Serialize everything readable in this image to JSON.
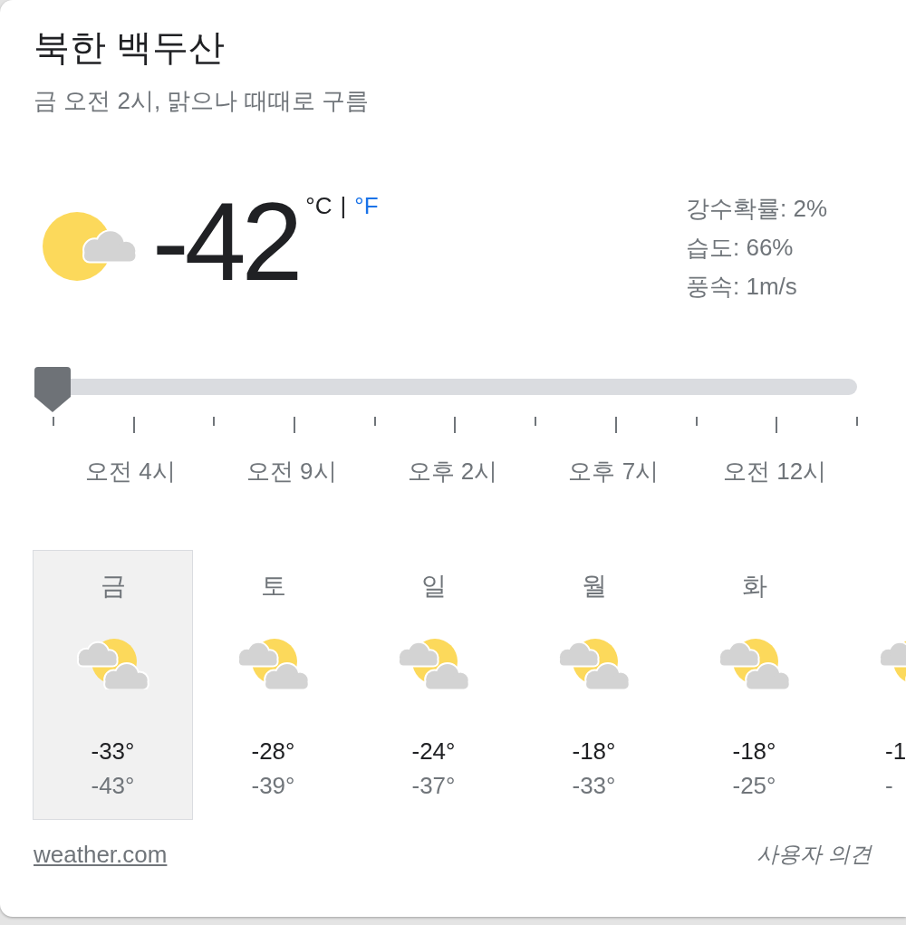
{
  "location": {
    "title": "북한 백두산",
    "subtitle": "금 오전 2시, 맑으나 때때로 구름"
  },
  "current": {
    "temperature": "-42",
    "units": [
      {
        "label": "°C",
        "selected": true
      },
      {
        "label": "°F",
        "selected": false
      }
    ],
    "unit_separator": "|",
    "details": [
      "강수확률: 2%",
      "습도: 66%",
      "풍속: 1m/s"
    ]
  },
  "hourly_slider": {
    "level": 0,
    "hour_labels": [
      "오전 4시",
      "오전 9시",
      "오후 2시",
      "오후 7시",
      "오전 12시"
    ]
  },
  "days": [
    {
      "day": "금",
      "high": "-33°",
      "low": "-43°",
      "selected": true
    },
    {
      "day": "토",
      "high": "-28°",
      "low": "-39°",
      "selected": false
    },
    {
      "day": "일",
      "high": "-24°",
      "low": "-37°",
      "selected": false
    },
    {
      "day": "월",
      "high": "-18°",
      "low": "-33°",
      "selected": false
    },
    {
      "day": "화",
      "high": "-18°",
      "low": "-25°",
      "selected": false
    },
    {
      "high": "-1",
      "low": "-",
      "selected": false
    }
  ],
  "footer": {
    "source_link": "weather.com",
    "feedback": "사용자 의견"
  }
}
